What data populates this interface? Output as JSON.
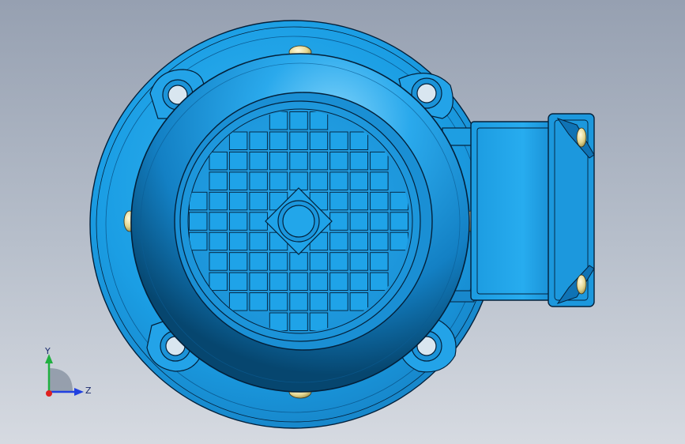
{
  "viewport": {
    "background_top": "#96a0b1",
    "background_bottom": "#d6dae1"
  },
  "model": {
    "body_color": "#1fa3e8",
    "dark_color": "#0b5c94",
    "edge_color": "#03203a",
    "bolt_color": "#e7dc9a",
    "fan_cover_grille_rows": 11
  },
  "triad": {
    "y_label": "Y",
    "z_label": "Z",
    "y_color": "#20b040",
    "z_color": "#2040e0",
    "origin_color": "#e02020"
  }
}
